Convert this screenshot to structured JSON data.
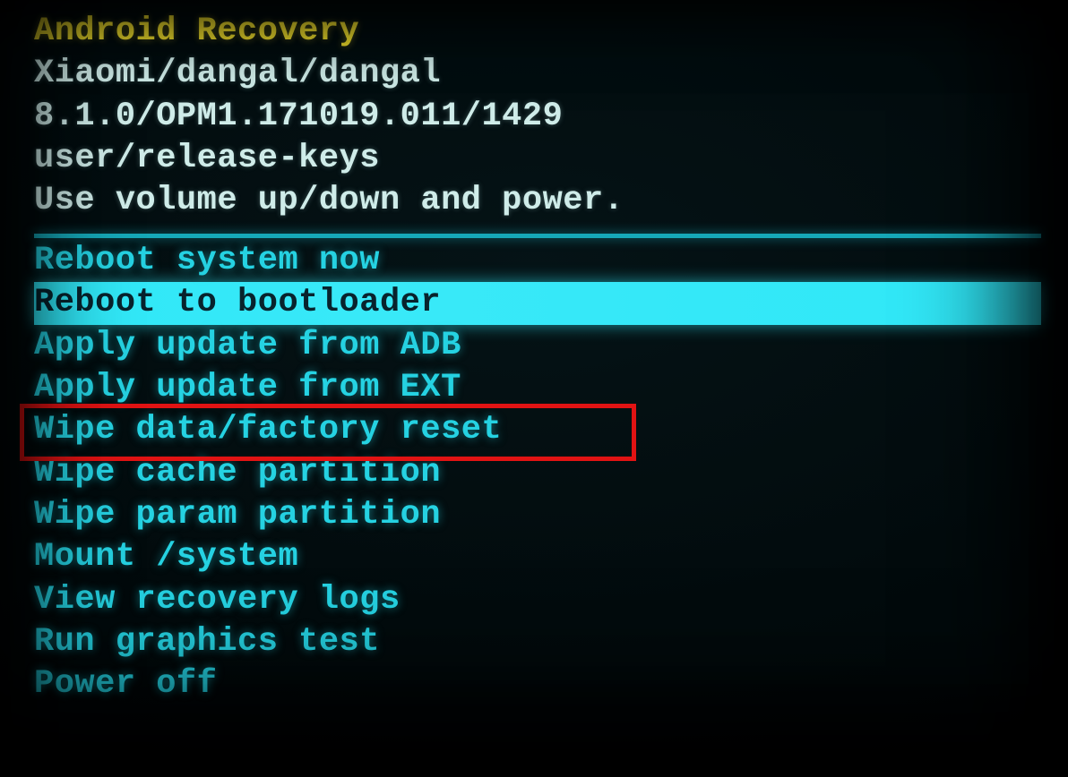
{
  "header": {
    "title": "Android Recovery",
    "device": "Xiaomi/dangal/dangal",
    "build": "8.1.0/OPM1.171019.011/1429",
    "keys": "user/release-keys",
    "hint": "Use volume up/down and power."
  },
  "menu": {
    "items": [
      {
        "label": "Reboot system now",
        "selected": false,
        "highlighted": false
      },
      {
        "label": "Reboot to bootloader",
        "selected": true,
        "highlighted": false
      },
      {
        "label": "Apply update from ADB",
        "selected": false,
        "highlighted": false
      },
      {
        "label": "Apply update from EXT",
        "selected": false,
        "highlighted": false
      },
      {
        "label": "Wipe data/factory reset",
        "selected": false,
        "highlighted": true
      },
      {
        "label": "Wipe cache partition",
        "selected": false,
        "highlighted": false
      },
      {
        "label": "Wipe param partition",
        "selected": false,
        "highlighted": false
      },
      {
        "label": "Mount /system",
        "selected": false,
        "highlighted": false
      },
      {
        "label": "View recovery logs",
        "selected": false,
        "highlighted": false
      },
      {
        "label": "Run graphics test",
        "selected": false,
        "highlighted": false
      },
      {
        "label": "Power off",
        "selected": false,
        "highlighted": false
      }
    ]
  },
  "colors": {
    "title": "#fbe92f",
    "text": "#cfece9",
    "menu": "#25d2e2",
    "selected_bg": "#2fe7f7",
    "highlight_border": "#e11313",
    "background": "#000608"
  }
}
